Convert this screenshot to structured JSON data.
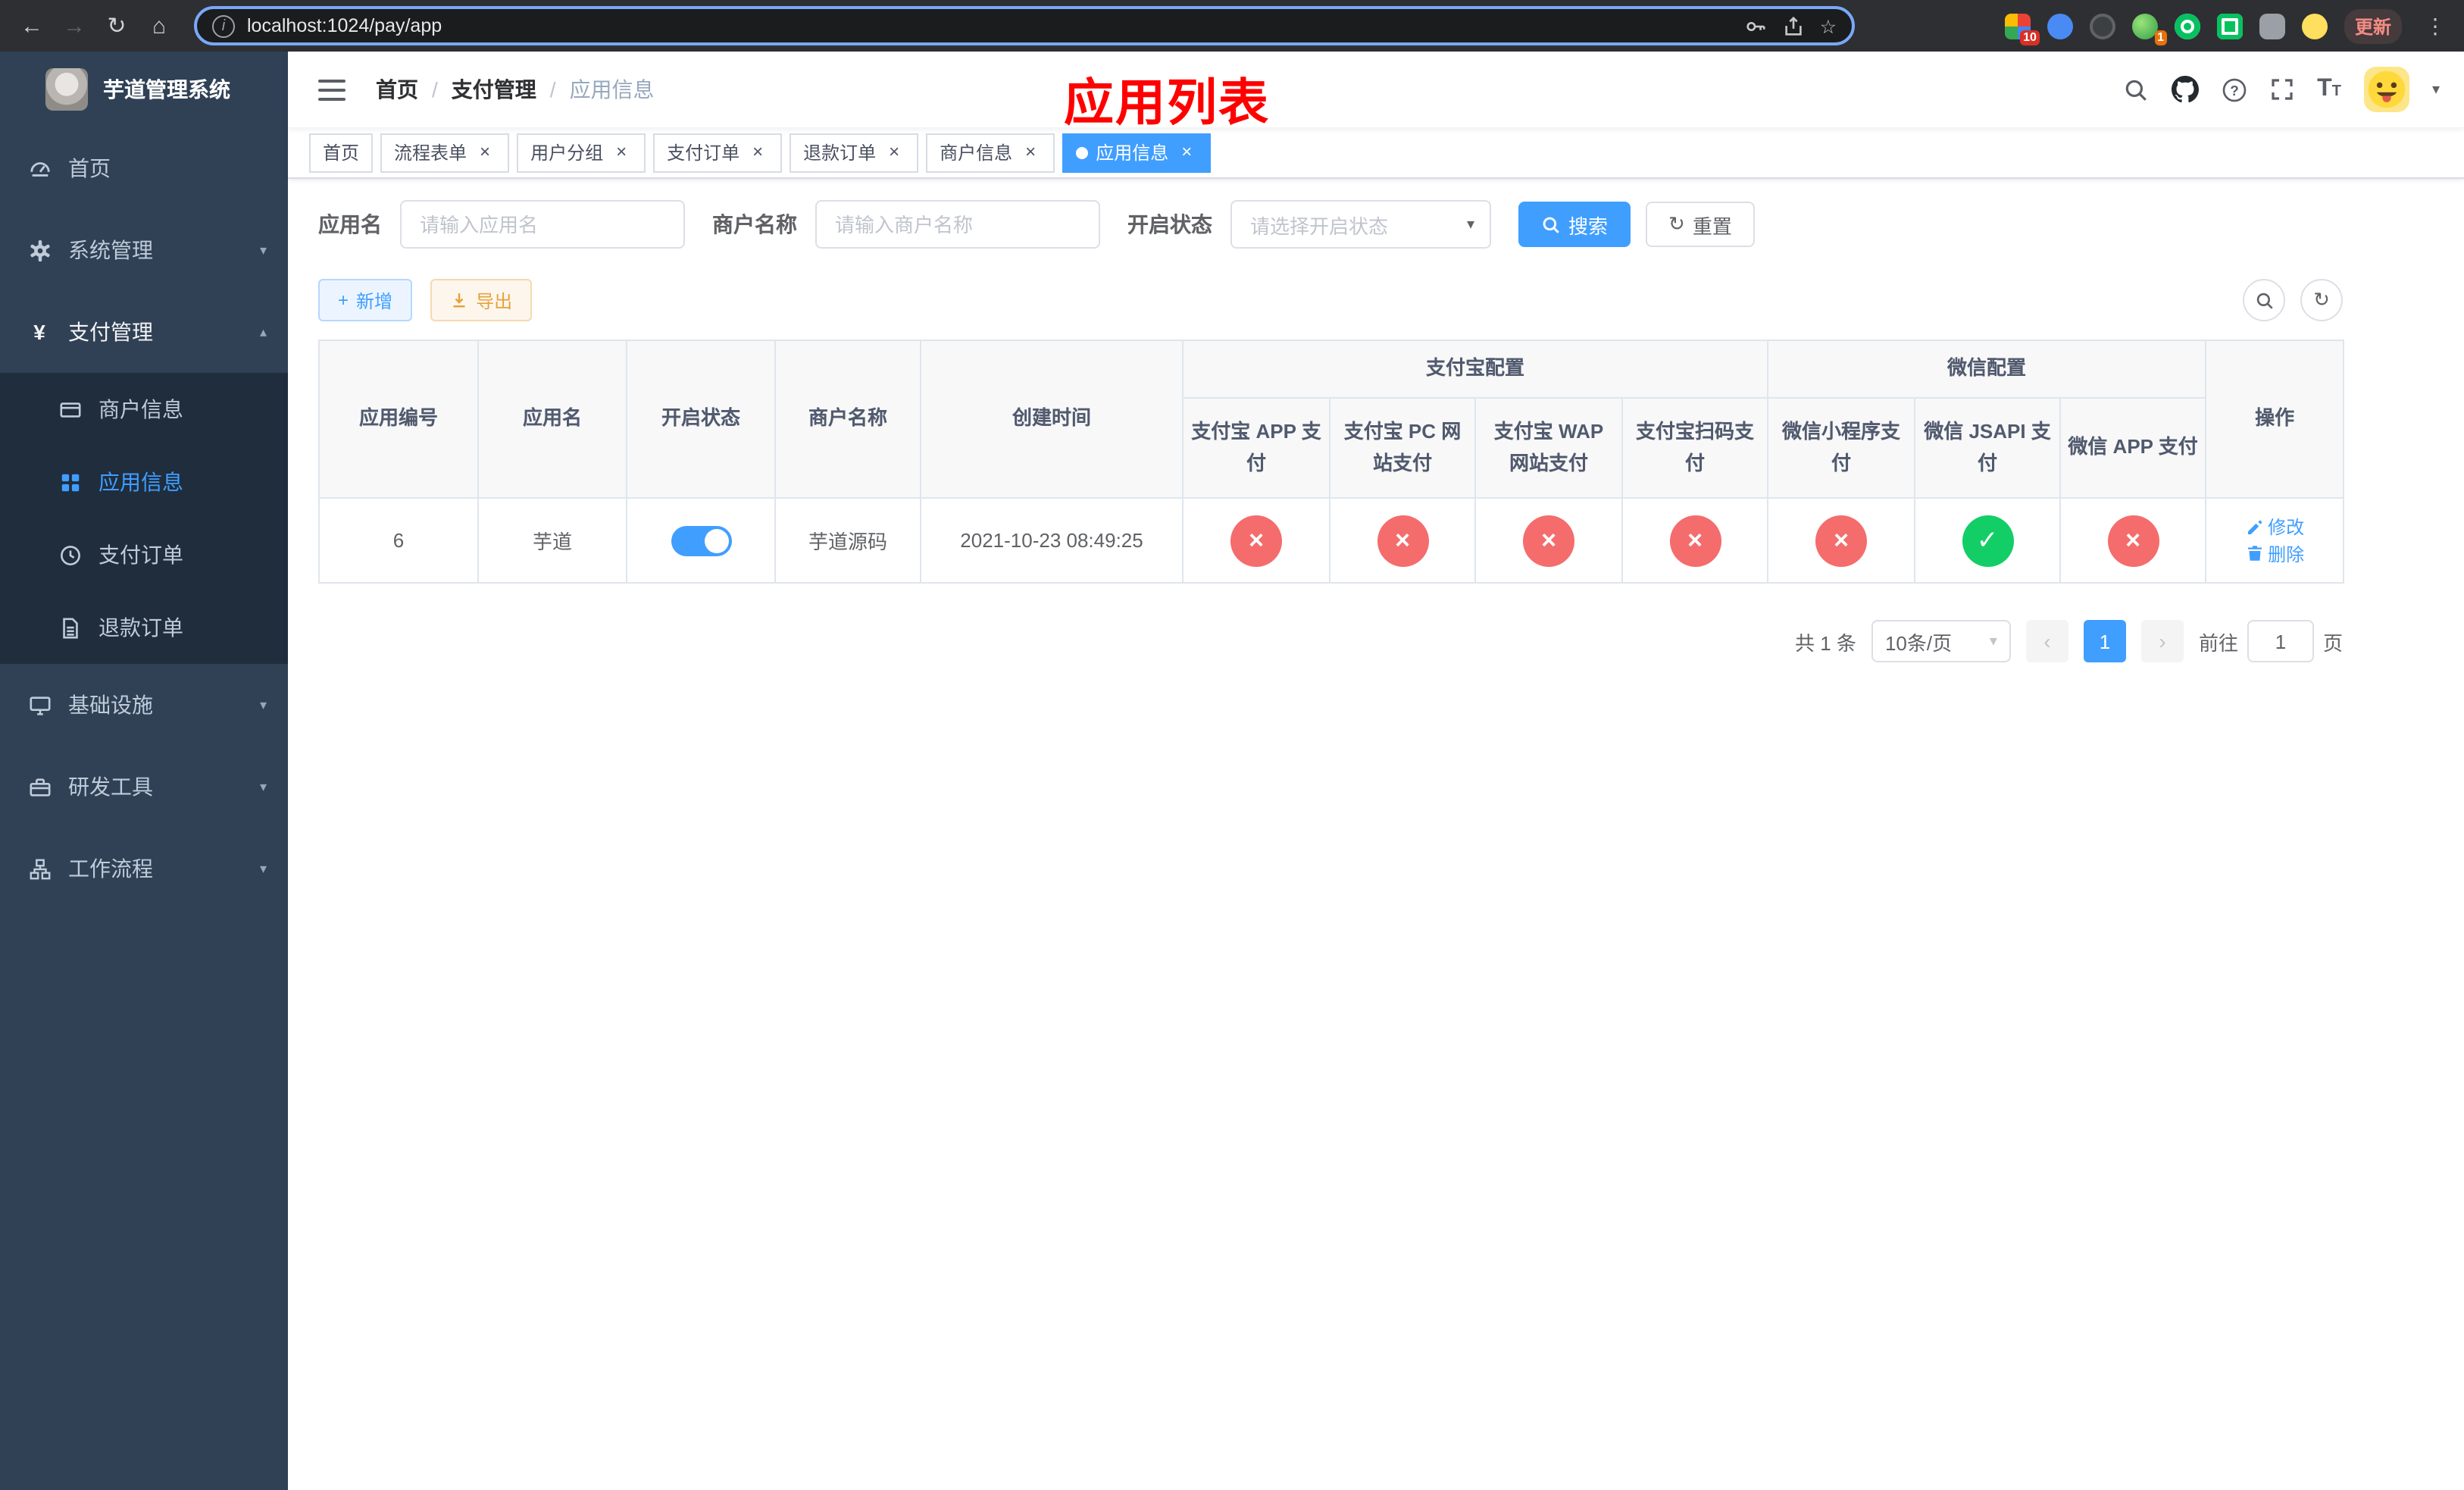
{
  "browser": {
    "url": "localhost:1024/pay/app",
    "update_label": "更新",
    "ext_badge_1": "10",
    "ext_badge_2": "1"
  },
  "icons": {
    "back": "←",
    "forward": "→",
    "reload": "↻",
    "home": "⌂",
    "info": "i",
    "star": "☆",
    "menu_dots": "⋮",
    "close": "×",
    "caret_down": "▾",
    "caret_up": "▴",
    "plus": "+",
    "yen": "¥",
    "refresh": "↻",
    "prev": "‹",
    "next": "›",
    "check": "✓",
    "cross": "×",
    "font_big": "T",
    "font_small": "T"
  },
  "sidebar": {
    "title": "芋道管理系统",
    "items": {
      "home": "首页",
      "system": "系统管理",
      "payment": "支付管理",
      "merchant": "商户信息",
      "app": "应用信息",
      "pay_order": "支付订单",
      "refund_order": "退款订单",
      "infra": "基础设施",
      "devtools": "研发工具",
      "workflow": "工作流程"
    }
  },
  "header": {
    "breadcrumb": {
      "home": "首页",
      "section": "支付管理",
      "current": "应用信息"
    },
    "annotation": "应用列表"
  },
  "tabs": [
    {
      "label": "首页"
    },
    {
      "label": "流程表单"
    },
    {
      "label": "用户分组"
    },
    {
      "label": "支付订单"
    },
    {
      "label": "退款订单"
    },
    {
      "label": "商户信息"
    },
    {
      "label": "应用信息"
    }
  ],
  "filters": {
    "app_name": {
      "label": "应用名",
      "placeholder": "请输入应用名",
      "value": ""
    },
    "merchant_name": {
      "label": "商户名称",
      "placeholder": "请输入商户名称",
      "value": ""
    },
    "status": {
      "label": "开启状态",
      "placeholder": "请选择开启状态"
    },
    "search": "搜索",
    "reset": "重置"
  },
  "toolbar": {
    "add": "新增",
    "export": "导出"
  },
  "table": {
    "groups": {
      "alipay": "支付宝配置",
      "wechat": "微信配置"
    },
    "headers": {
      "id": "应用编号",
      "name": "应用名",
      "status": "开启状态",
      "merchant": "商户名称",
      "created": "创建时间",
      "alipay_app": "支付宝 APP 支付",
      "alipay_pc": "支付宝 PC 网站支付",
      "alipay_wap": "支付宝 WAP 网站支付",
      "alipay_qr": "支付宝扫码支付",
      "wx_mini": "微信小程序支付",
      "wx_jsapi": "微信 JSAPI 支付",
      "wx_app": "微信 APP 支付",
      "op": "操作"
    },
    "row": {
      "id": "6",
      "name": "芋道",
      "enabled": true,
      "merchant": "芋道源码",
      "created": "2021-10-23 08:49:25",
      "configs": [
        false,
        false,
        false,
        false,
        false,
        true,
        false
      ],
      "edit": "修改",
      "delete": "删除"
    }
  },
  "pagination": {
    "total": "共 1 条",
    "page_size": "10条/页",
    "page": "1",
    "goto_prefix": "前往",
    "goto_value": "1",
    "goto_suffix": "页"
  },
  "colors": {
    "accent": "#409eff",
    "success": "#13ce66",
    "danger": "#f56c6c",
    "warning": "#e6a23c",
    "sidebar_bg": "#304156",
    "submenu_bg": "#1f2d3d",
    "annotation": "#ff0000"
  }
}
